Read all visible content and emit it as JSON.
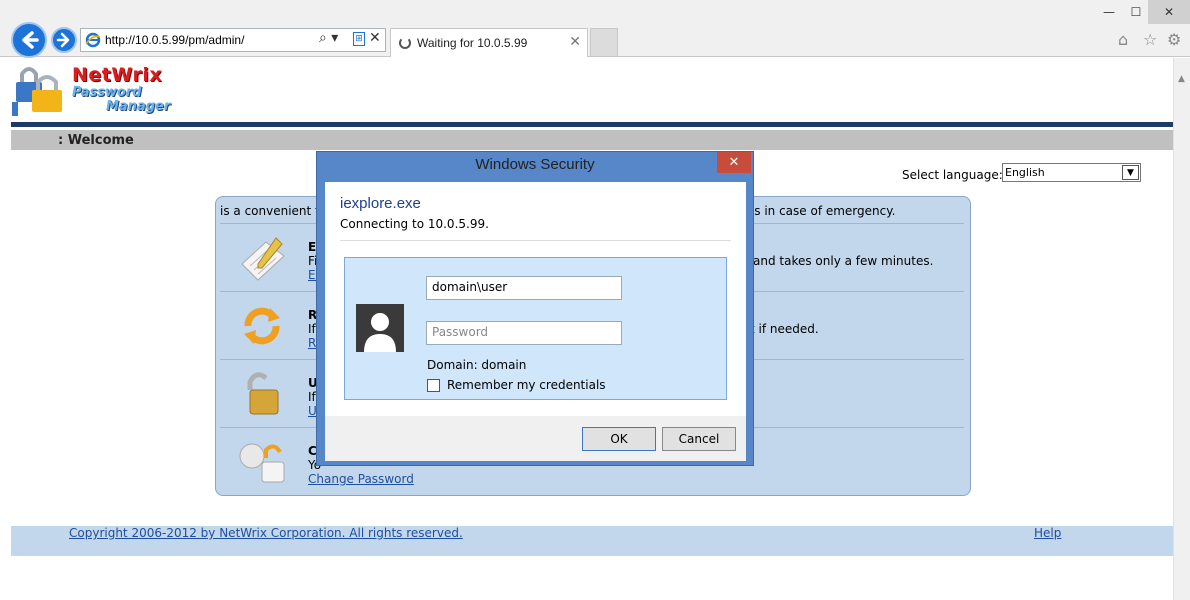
{
  "browser": {
    "url": "http://10.0.5.99/pm/admin/",
    "tab_title": "Waiting for 10.0.5.99",
    "address_controls": "⌕ ▾",
    "minimize_icon": "—",
    "maximize_icon": "☐",
    "close_icon": "✕"
  },
  "page": {
    "logo_line1": "NetWrix",
    "logo_line2a": "Password",
    "logo_line2b": "Manager",
    "welcome": ": Welcome",
    "language_label": "Select language:",
    "language_value": "English",
    "intro_start": "is a convenient t",
    "intro_end": "ss in case of emergency.",
    "rows": [
      {
        "title": "Er",
        "text": "Fi",
        "link": "Er",
        "end": "and takes only a few minutes."
      },
      {
        "title": "Re",
        "text": "If",
        "link": "Re",
        "end": "t if needed."
      },
      {
        "title": "Ul",
        "text": "If",
        "link": "Ul",
        "end": ""
      },
      {
        "title": "Cl",
        "text": "Yo",
        "link": "Change Password",
        "end": ""
      }
    ],
    "copyright": "Copyright 2006-2012 by NetWrix Corporation. All rights reserved.",
    "help": "Help"
  },
  "dialog": {
    "title": "Windows Security",
    "app": "iexplore.exe",
    "connecting": "Connecting to 10.0.5.99.",
    "username": "domain\\user",
    "password_placeholder": "Password",
    "domain": "Domain: domain",
    "remember": "Remember my credentials",
    "ok": "OK",
    "cancel": "Cancel"
  }
}
